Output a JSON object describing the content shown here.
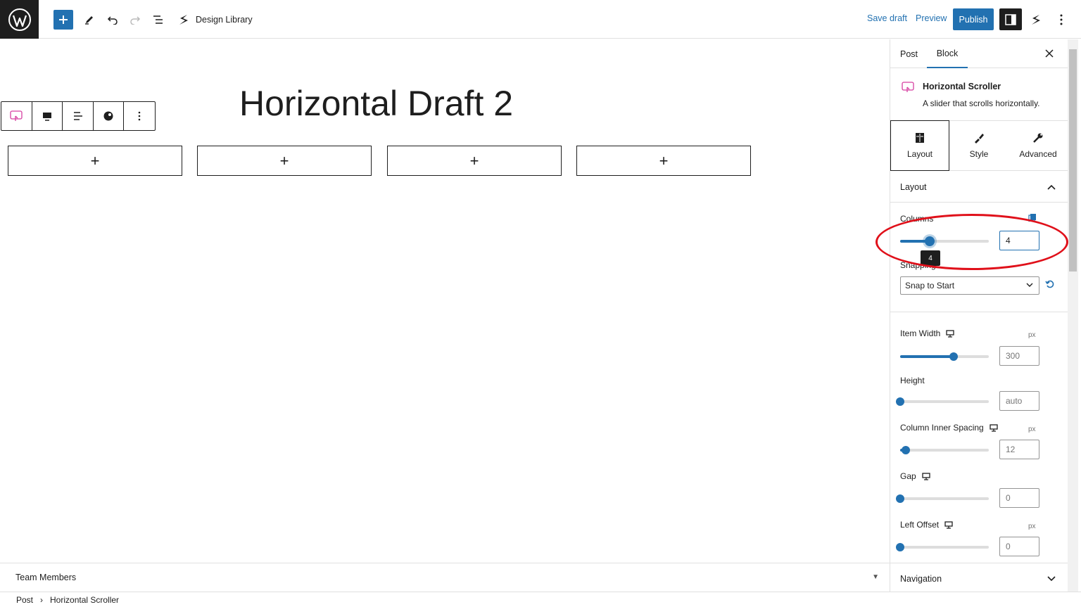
{
  "topbar": {
    "design_library_label": "Design Library",
    "save_draft_label": "Save draft",
    "preview_label": "Preview",
    "publish_label": "Publish"
  },
  "canvas": {
    "post_title": "Horizontal Draft 2",
    "appenders": [
      "+",
      "+",
      "+",
      "+"
    ]
  },
  "bottom": {
    "panel_title": "Team Members",
    "breadcrumb": [
      "Post",
      "›",
      "Horizontal Scroller"
    ]
  },
  "sidebar": {
    "tabs": [
      "Post",
      "Block"
    ],
    "active_tab": "Block",
    "block_card": {
      "title": "Horizontal Scroller",
      "description": "A slider that scrolls horizontally."
    },
    "settings_tabs": [
      "Layout",
      "Style",
      "Advanced"
    ],
    "layout_panel_title": "Layout",
    "controls": {
      "columns": {
        "label": "Columns",
        "value": "4",
        "tooltip": "4",
        "level": 0.33
      },
      "snapping": {
        "label": "Snapping",
        "value": "Snap to Start"
      },
      "item_width": {
        "label": "Item Width",
        "unit": "px",
        "value": "300",
        "level": 0.6
      },
      "height": {
        "label": "Height",
        "value": "auto",
        "level": 0.0
      },
      "column_inner_spacing": {
        "label": "Column Inner Spacing",
        "unit": "px",
        "value": "12",
        "level": 0.06
      },
      "gap": {
        "label": "Gap",
        "value": "0",
        "level": 0.0
      },
      "left_offset": {
        "label": "Left Offset",
        "unit": "px",
        "value": "0",
        "level": 0.0
      }
    },
    "navigation_panel_title": "Navigation"
  },
  "colors": {
    "accent": "#2271b1",
    "annotation": "#e0101a",
    "dark": "#1e1e1e"
  }
}
